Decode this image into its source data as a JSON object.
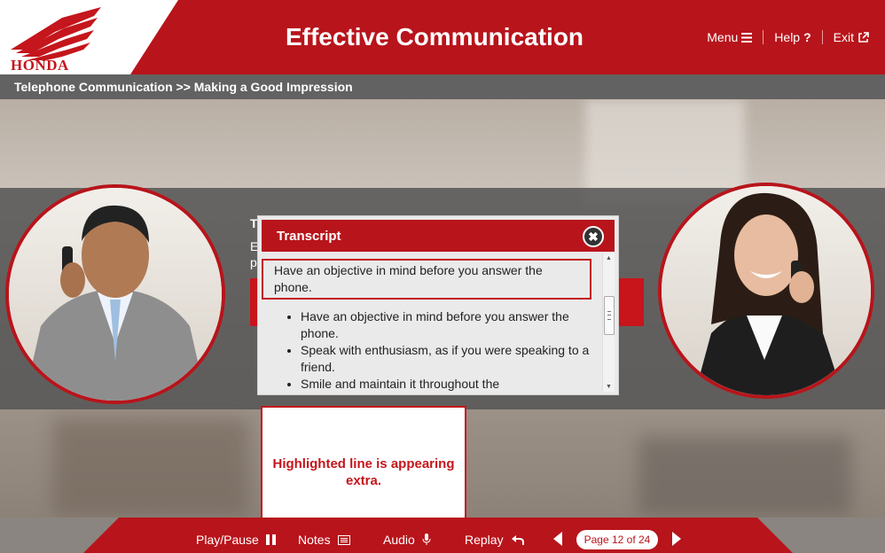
{
  "header": {
    "brand": "HONDA",
    "title": "Effective Communication",
    "menu_label": "Menu",
    "help_label": "Help",
    "exit_label": "Exit"
  },
  "breadcrumb": "Telephone Communication >> Making a Good Impression",
  "behind": {
    "line1": "To",
    "line2": "E",
    "line3": "p"
  },
  "transcript": {
    "title": "Transcript",
    "close_symbol": "✖",
    "highlighted_line": "Have an objective in mind before you answer the phone.",
    "bullets": [
      "Have an objective in mind before you answer the phone.",
      "Speak with enthusiasm, as if you were speaking to a friend.",
      "Smile and maintain it throughout the"
    ]
  },
  "annotation": "Highlighted line is appearing extra.",
  "footer": {
    "play_pause": "Play/Pause",
    "notes": "Notes",
    "audio": "Audio",
    "replay": "Replay",
    "page": "Page 12 of 24"
  },
  "colors": {
    "brand_red": "#b8141b",
    "annotation_red": "#c4161c",
    "crumb_gray": "#636262"
  },
  "icons": [
    "honda-wing-icon",
    "menu-icon",
    "help-icon",
    "external-link-icon",
    "close-icon",
    "pause-icon",
    "notes-icon",
    "microphone-icon",
    "replay-icon",
    "prev-arrow-icon",
    "next-arrow-icon"
  ]
}
